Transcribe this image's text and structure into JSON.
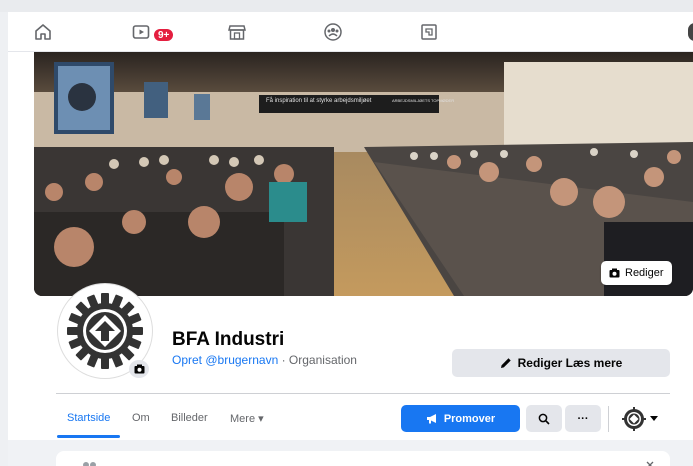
{
  "topbar": {
    "icons": [
      "home-icon",
      "video-icon",
      "marketplace-icon",
      "groups-icon",
      "gaming-icon"
    ],
    "video_badge": "9+"
  },
  "cover": {
    "banner_text_left": "Få inspiration til at styrke arbejdsmiljøet",
    "banner_text_right": "ARBEJDSMILJØETS TOPMØDER",
    "edit_label": "Rediger"
  },
  "profile": {
    "name": "BFA Industri",
    "username_link": "Opret @brugernavn",
    "separator": " · ",
    "category": "Organisation"
  },
  "actions": {
    "edit_read_more": "Rediger Læs mere",
    "promote": "Promover",
    "more_dots": "···"
  },
  "tabs": [
    {
      "label": "Startside",
      "active": true
    },
    {
      "label": "Om",
      "active": false
    },
    {
      "label": "Billeder",
      "active": false
    },
    {
      "label": "Mere ▾",
      "active": false
    }
  ],
  "colors": {
    "accent": "#1877f2",
    "badge": "#e41e3f",
    "button_grey": "#e4e6eb"
  }
}
